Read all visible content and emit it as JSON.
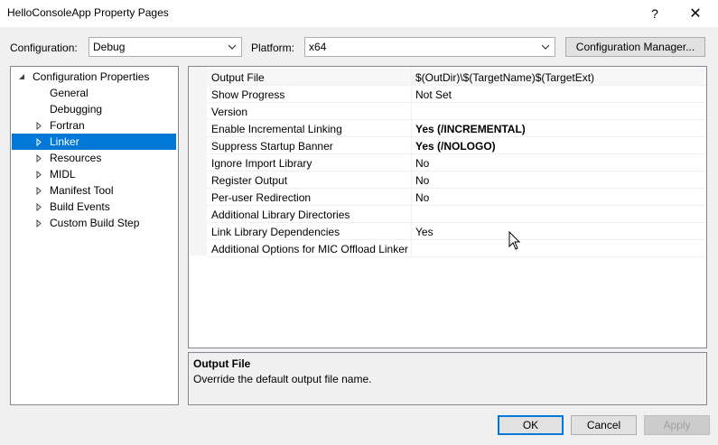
{
  "window": {
    "title": "HelloConsoleApp Property Pages",
    "help_glyph": "?",
    "close_glyph": "✕"
  },
  "toolbar": {
    "configuration_label": "Configuration:",
    "configuration_value": "Debug",
    "platform_label": "Platform:",
    "platform_value": "x64",
    "config_manager_label": "Configuration Manager..."
  },
  "tree": {
    "items": [
      {
        "label": "Configuration Properties",
        "expander": "expanded"
      },
      {
        "label": "General",
        "expander": "none"
      },
      {
        "label": "Debugging",
        "expander": "none"
      },
      {
        "label": "Fortran",
        "expander": "collapsed"
      },
      {
        "label": "Linker",
        "expander": "collapsed",
        "selected": true
      },
      {
        "label": "Resources",
        "expander": "collapsed"
      },
      {
        "label": "MIDL",
        "expander": "collapsed"
      },
      {
        "label": "Manifest Tool",
        "expander": "collapsed"
      },
      {
        "label": "Build Events",
        "expander": "collapsed"
      },
      {
        "label": "Custom Build Step",
        "expander": "collapsed"
      }
    ]
  },
  "grid": {
    "rows": [
      {
        "name": "Output File",
        "value": "$(OutDir)\\$(TargetName)$(TargetExt)",
        "bold": false
      },
      {
        "name": "Show Progress",
        "value": "Not Set",
        "bold": false
      },
      {
        "name": "Version",
        "value": "",
        "bold": false
      },
      {
        "name": "Enable Incremental Linking",
        "value": "Yes (/INCREMENTAL)",
        "bold": true
      },
      {
        "name": "Suppress Startup Banner",
        "value": "Yes (/NOLOGO)",
        "bold": true
      },
      {
        "name": "Ignore Import Library",
        "value": "No",
        "bold": false
      },
      {
        "name": "Register Output",
        "value": "No",
        "bold": false
      },
      {
        "name": "Per-user Redirection",
        "value": "No",
        "bold": false
      },
      {
        "name": "Additional Library Directories",
        "value": "",
        "bold": false
      },
      {
        "name": "Link Library Dependencies",
        "value": "Yes",
        "bold": false
      },
      {
        "name": "Additional Options for MIC Offload Linker",
        "value": "",
        "bold": false
      }
    ]
  },
  "description": {
    "title": "Output File",
    "text": "Override the default output file name."
  },
  "buttons": {
    "ok": "OK",
    "cancel": "Cancel",
    "apply": "Apply"
  },
  "colors": {
    "selection": "#0078d7",
    "window_bg": "#f0f0f0"
  }
}
